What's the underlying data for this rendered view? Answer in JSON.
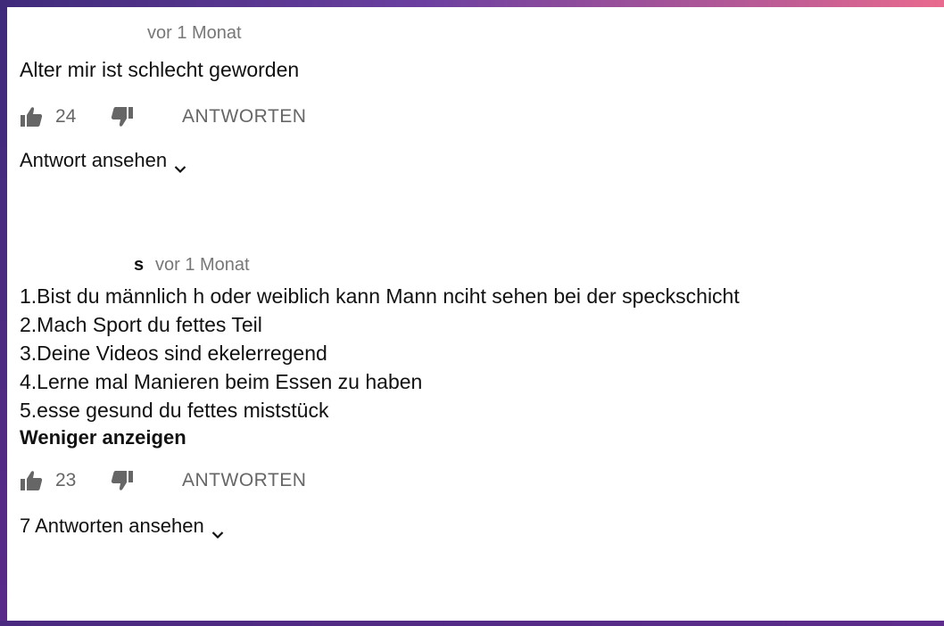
{
  "comments": [
    {
      "author": "",
      "time": "vor 1 Monat",
      "lines": [
        "Alter mir ist schlecht geworden"
      ],
      "likes": "24",
      "reply_label": "ANTWORTEN",
      "view_replies": "Antwort ansehen"
    },
    {
      "author": "s",
      "time": "vor 1 Monat",
      "lines": [
        "1.Bist du männlich h oder weiblich kann Mann nciht sehen bei der speckschicht",
        "2.Mach Sport du fettes Teil",
        "3.Deine Videos sind ekelerregend",
        "4.Lerne mal Manieren beim Essen zu haben",
        "5.esse gesund du fettes miststück"
      ],
      "show_less": "Weniger anzeigen",
      "likes": "23",
      "reply_label": "ANTWORTEN",
      "view_replies": "7 Antworten ansehen"
    }
  ],
  "icons": {
    "like": "thumb-up-icon",
    "dislike": "thumb-down-icon",
    "expand": "chevron-down-icon"
  },
  "colors": {
    "text": "#111111",
    "meta": "#777777",
    "action": "#666666",
    "frame_accent": "#e96a8e"
  }
}
